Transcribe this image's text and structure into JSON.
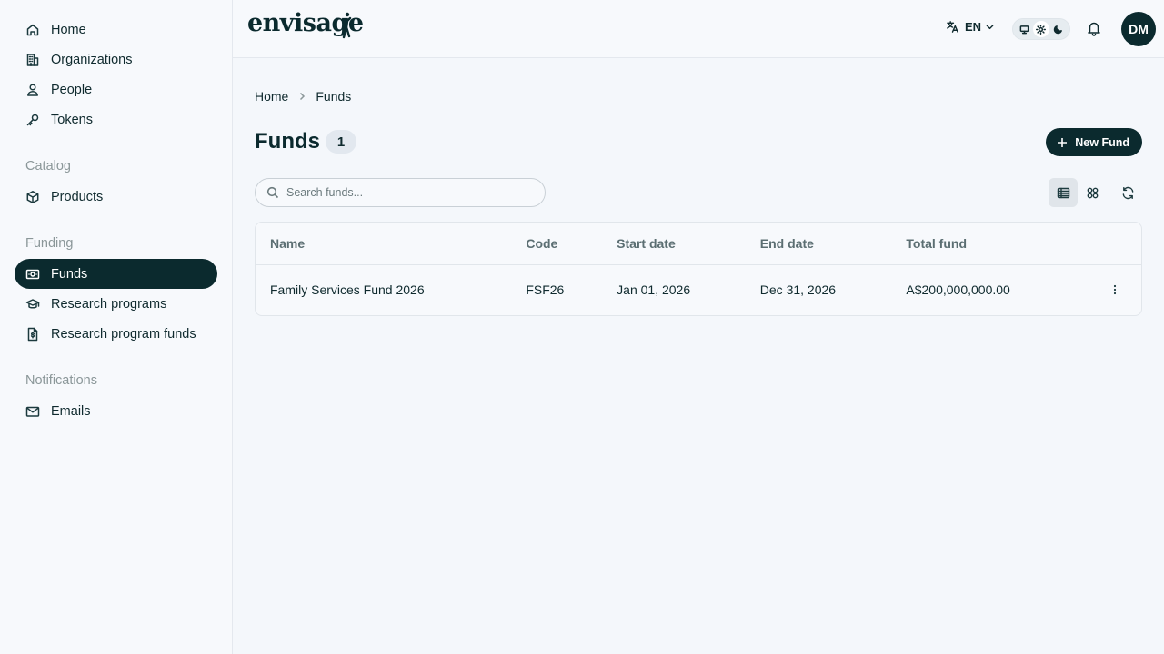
{
  "brand": {
    "logo_text": "envisage"
  },
  "sidebar": {
    "main_items": [
      {
        "label": "Home",
        "icon": "home-icon"
      },
      {
        "label": "Organizations",
        "icon": "building-icon"
      },
      {
        "label": "People",
        "icon": "person-icon"
      },
      {
        "label": "Tokens",
        "icon": "key-icon"
      }
    ],
    "catalog": {
      "title": "Catalog",
      "items": [
        {
          "label": "Products",
          "icon": "box-icon"
        }
      ]
    },
    "funding": {
      "title": "Funding",
      "items": [
        {
          "label": "Funds",
          "icon": "banknote-icon",
          "active": true
        },
        {
          "label": "Research programs",
          "icon": "graduation-cap-icon"
        },
        {
          "label": "Research program funds",
          "icon": "file-dollar-icon"
        }
      ]
    },
    "notifications": {
      "title": "Notifications",
      "items": [
        {
          "label": "Emails",
          "icon": "mail-icon"
        }
      ]
    }
  },
  "topbar": {
    "language": "EN",
    "theme_options": [
      "system",
      "light",
      "dark"
    ],
    "theme_selected": "light",
    "avatar_initials": "DM"
  },
  "breadcrumb": {
    "items": [
      "Home",
      "Funds"
    ]
  },
  "page": {
    "title": "Funds",
    "count": "1",
    "new_button_label": "New Fund",
    "search_placeholder": "Search funds...",
    "view_selected": "table"
  },
  "table": {
    "columns": [
      "Name",
      "Code",
      "Start date",
      "End date",
      "Total fund"
    ],
    "rows": [
      {
        "name": "Family Services Fund 2026",
        "code": "FSF26",
        "start_date": "Jan 01, 2026",
        "end_date": "Dec 31, 2026",
        "total_fund": "A$200,000,000.00"
      }
    ]
  },
  "colors": {
    "accent": "#0b2a2e",
    "background": "#f4f7fb",
    "muted_text": "#8b9799"
  }
}
